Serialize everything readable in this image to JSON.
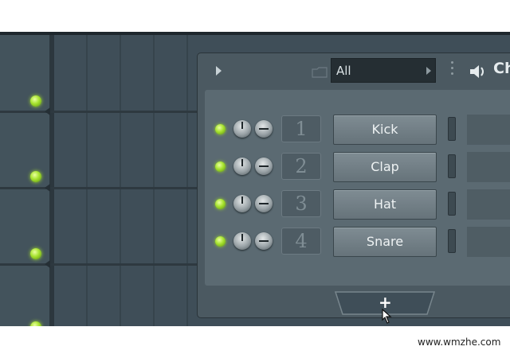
{
  "rack": {
    "filter_value": "All",
    "title_partial": "Ch",
    "add_button": "+",
    "channels": [
      {
        "number": "1",
        "name": "Kick"
      },
      {
        "number": "2",
        "name": "Clap"
      },
      {
        "number": "3",
        "name": "Hat"
      },
      {
        "number": "4",
        "name": "Snare"
      }
    ]
  },
  "watermark": "www.wmzhe.com",
  "colors": {
    "led_green": "#a6e22e",
    "playlist_bg": "#3f4e58",
    "rack_bg": "#4b5961",
    "rack_body": "#5b6a72",
    "button_face": "#737f86"
  },
  "icons": [
    "play-arrow-icon",
    "folder-icon",
    "dropdown-arrow-icon",
    "menu-dots-icon",
    "speaker-icon",
    "plus-icon",
    "hand-cursor-icon"
  ]
}
